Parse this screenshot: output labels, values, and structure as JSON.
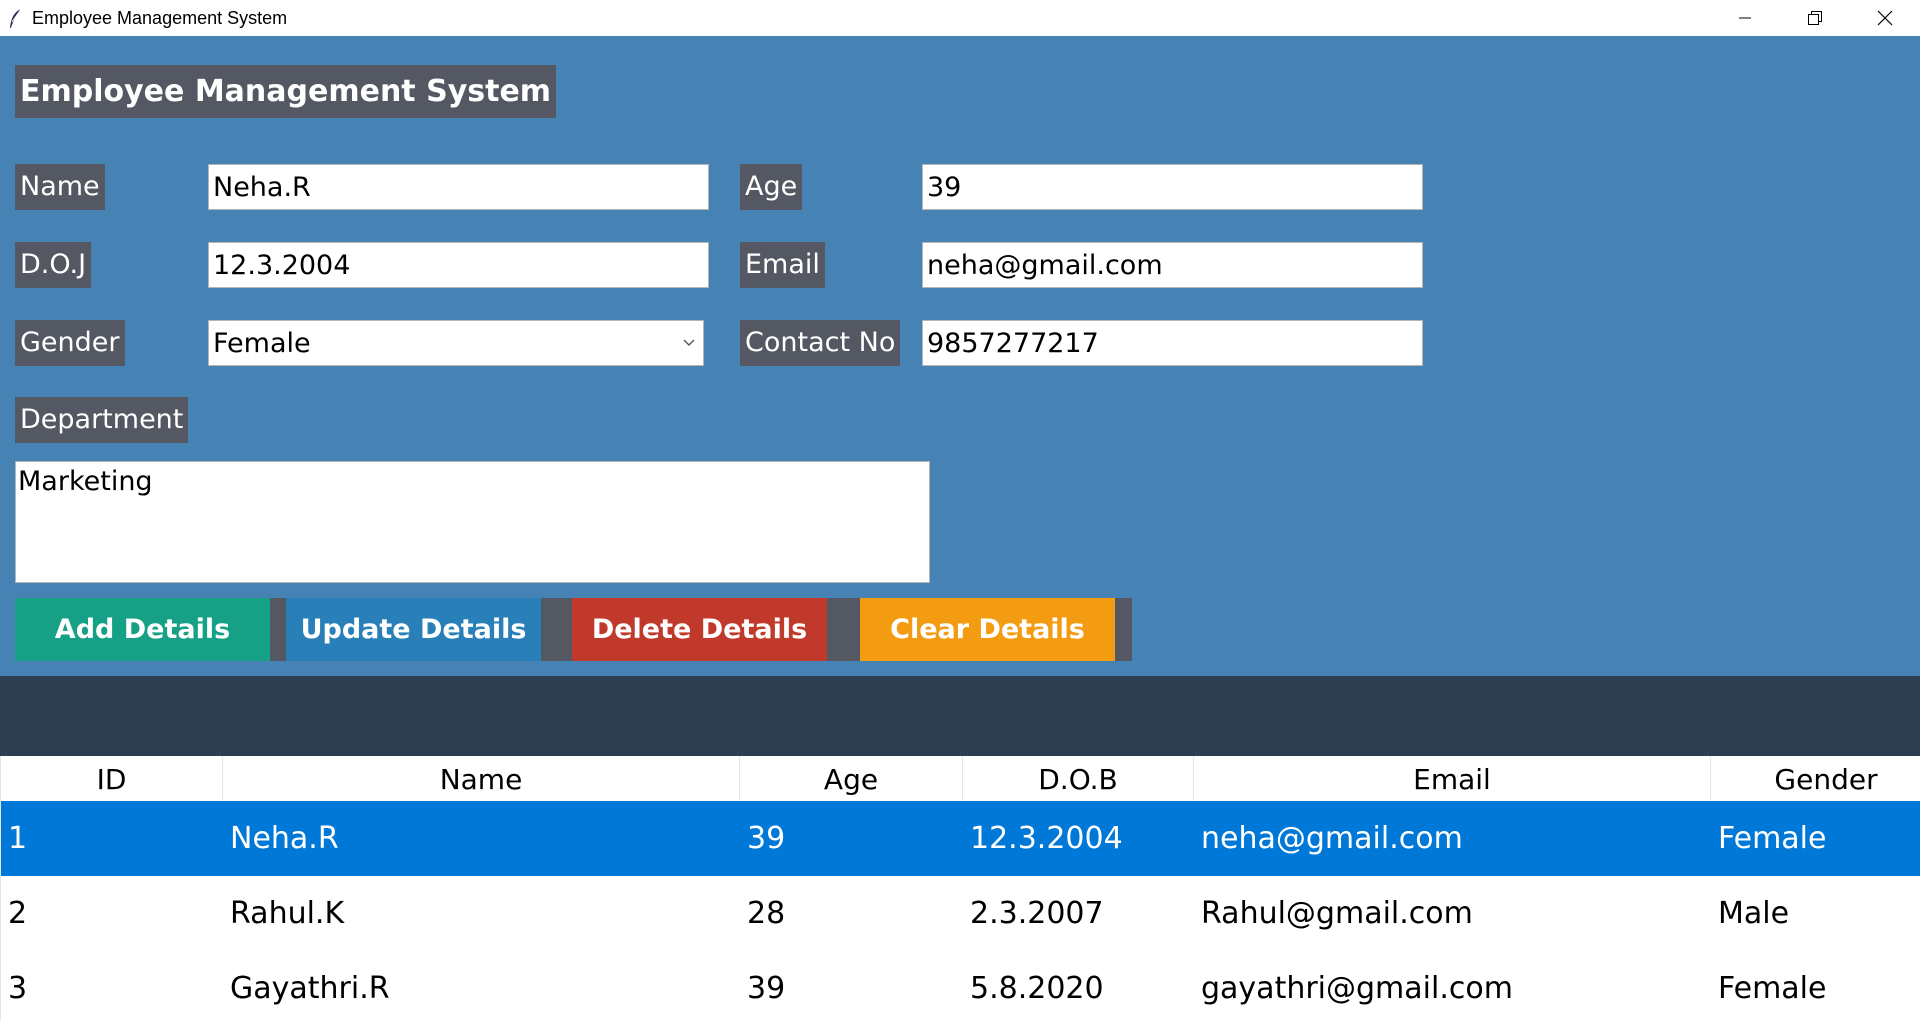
{
  "window": {
    "title": "Employee Management System",
    "icon": "feather-icon"
  },
  "form": {
    "heading": "Employee Management System",
    "name": {
      "label": "Name",
      "value": "Neha.R"
    },
    "age": {
      "label": "Age",
      "value": "39"
    },
    "doj": {
      "label": "D.O.J",
      "value": "12.3.2004"
    },
    "email": {
      "label": "Email",
      "value": "neha@gmail.com"
    },
    "gender": {
      "label": "Gender",
      "value": "Female"
    },
    "contact": {
      "label": "Contact No",
      "value": "9857277217"
    },
    "department": {
      "label": "Department",
      "value": "Marketing"
    }
  },
  "buttons": {
    "add": "Add Details",
    "update": "Update Details",
    "delete": "Delete Details",
    "clear": "Clear Details"
  },
  "colors": {
    "panel": "#4682b4",
    "label_bg": "#545863",
    "add": "#16a085",
    "update": "#2980b9",
    "delete": "#c0392b",
    "clear": "#f39c12",
    "band": "#2c3e50",
    "selected_row": "#0078d7"
  },
  "table": {
    "headers": [
      "ID",
      "Name",
      "Age",
      "D.O.B",
      "Email",
      "Gender"
    ],
    "rows": [
      [
        "1",
        "Neha.R",
        "39",
        "12.3.2004",
        "neha@gmail.com",
        "Female"
      ],
      [
        "2",
        "Rahul.K",
        "28",
        "2.3.2007",
        "Rahul@gmail.com",
        "Male"
      ],
      [
        "3",
        "Gayathri.R",
        "39",
        "5.8.2020",
        "gayathri@gmail.com",
        "Female"
      ]
    ],
    "selected_index": 0
  }
}
